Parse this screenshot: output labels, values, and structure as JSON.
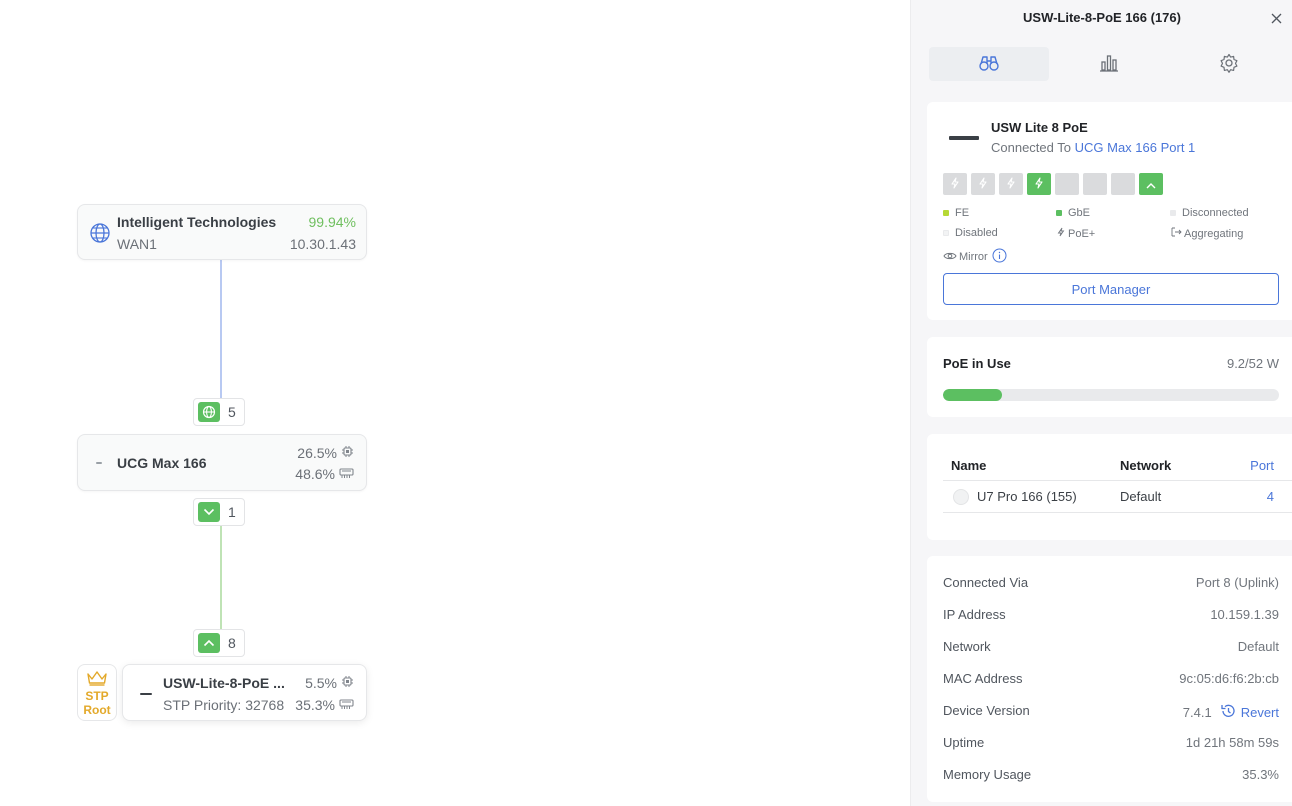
{
  "topology": {
    "internet": {
      "name": "Intelligent Technologies",
      "uptime": "99.94%",
      "wan": "WAN1",
      "ip": "10.30.1.43"
    },
    "link1": {
      "port": "5"
    },
    "gateway": {
      "name": "UCG Max 166",
      "cpu": "26.5%",
      "mem": "48.6%"
    },
    "link2": {
      "port": "1"
    },
    "link3": {
      "port": "8"
    },
    "switch": {
      "name": "USW-Lite-8-PoE ...",
      "sub": "STP Priority: 32768",
      "cpu": "5.5%",
      "mem": "35.3%"
    },
    "stp_badge": {
      "line1": "STP",
      "line2": "Root"
    }
  },
  "panel": {
    "title": "USW-Lite-8-PoE 166 (176)",
    "tabs": [
      {
        "label": "overview",
        "icon": "binoculars-icon",
        "active": true
      },
      {
        "label": "statistics",
        "icon": "bar-chart-icon",
        "active": false
      },
      {
        "label": "settings",
        "icon": "gear-icon",
        "active": false
      }
    ],
    "device": {
      "model": "USW Lite 8 PoE",
      "connected_prefix": "Connected To",
      "connected_link": "UCG Max 166 Port 1",
      "ports": [
        {
          "state": "poe",
          "up": false
        },
        {
          "state": "poe",
          "up": false
        },
        {
          "state": "poe",
          "up": false
        },
        {
          "state": "poe",
          "up": true
        },
        {
          "state": "empty",
          "up": false
        },
        {
          "state": "empty",
          "up": false
        },
        {
          "state": "empty",
          "up": false
        },
        {
          "state": "uplink",
          "up": true
        }
      ],
      "legend": {
        "fe": "FE",
        "gbe": "GbE",
        "disconnected": "Disconnected",
        "disabled": "Disabled",
        "poe": "PoE+",
        "aggregating": "Aggregating",
        "mirror": "Mirror"
      },
      "port_manager": "Port Manager"
    },
    "poe": {
      "label": "PoE in Use",
      "value": "9.2/52 W",
      "fraction": 0.177
    },
    "clients": {
      "headers": {
        "name": "Name",
        "network": "Network",
        "port": "Port"
      },
      "rows": [
        {
          "name": "U7 Pro 166 (155)",
          "network": "Default",
          "port": "4"
        }
      ]
    },
    "info": {
      "connected_via": {
        "label": "Connected Via",
        "value": "Port 8 (Uplink)"
      },
      "ip": {
        "label": "IP Address",
        "value": "10.159.1.39"
      },
      "network": {
        "label": "Network",
        "value": "Default"
      },
      "mac": {
        "label": "MAC Address",
        "value": "9c:05:d6:f6:2b:cb"
      },
      "version": {
        "label": "Device Version",
        "value": "7.4.1",
        "action": "Revert"
      },
      "uptime": {
        "label": "Uptime",
        "value": "1d 21h 58m 59s"
      },
      "memory": {
        "label": "Memory Usage",
        "value": "35.3%"
      }
    },
    "colors": {
      "accent": "#4a76d9",
      "green": "#5cbf61",
      "fe": "#b6d936",
      "stp": "#e3a92a"
    }
  }
}
